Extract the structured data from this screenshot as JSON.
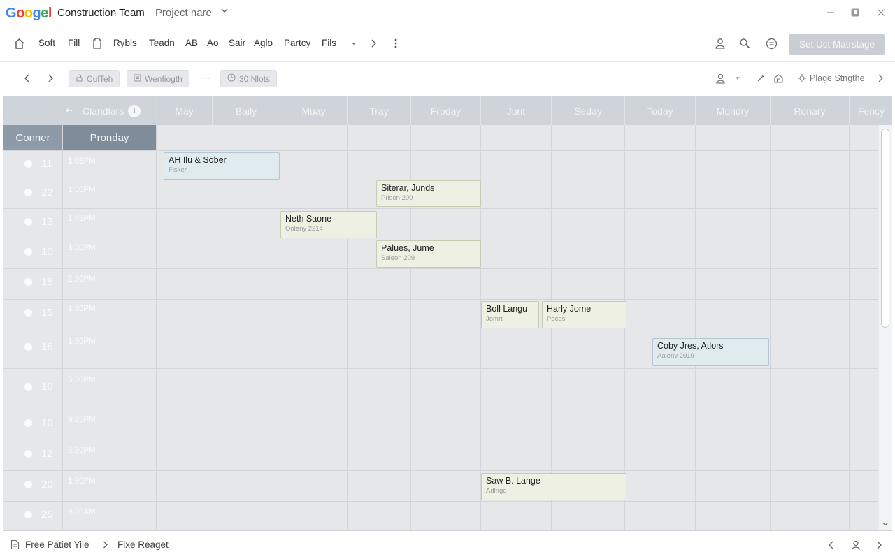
{
  "header": {
    "logo": [
      "G",
      "o",
      "o",
      "g",
      "e",
      "l"
    ],
    "logo_colors": [
      "#4285F4",
      "#EA4335",
      "#FBBC05",
      "#4285F4",
      "#34A853",
      "#EA4335"
    ],
    "app_title": "Construction Team",
    "project_name": "Project nare"
  },
  "menubar": {
    "items": [
      "Soft",
      "Fill",
      "Rybls",
      "Teadn",
      "AB",
      "Ao",
      "Sair",
      "Aglo",
      "Partcy",
      "Fils"
    ],
    "cta": "Set Uct Matrstage"
  },
  "toolbar": {
    "chip1": "CulTeh",
    "chip2": "Wenfiogth",
    "dots": "····",
    "chip3": "30 Nlots",
    "right_label": "Plage Stngthe"
  },
  "calendar": {
    "header_label": "Clandlars",
    "badge": "!",
    "days": [
      "May",
      "Baily",
      "Muay",
      "Tray",
      "Froday",
      "Junt",
      "Seday",
      "Today",
      "Mondry",
      "Ronary",
      "Fency"
    ],
    "sub_left": "Conner",
    "sub_right": "Pronday",
    "rows": [
      {
        "num": "11",
        "time": "1:05PM"
      },
      {
        "num": "22",
        "time": "1:30PM"
      },
      {
        "num": "13",
        "time": "1:45PM"
      },
      {
        "num": "10",
        "time": "1:30PM"
      },
      {
        "num": "18",
        "time": "2:30PM"
      },
      {
        "num": "15",
        "time": "1:30PM"
      },
      {
        "num": "16",
        "time": "1:30PM"
      },
      {
        "num": "10",
        "time": "5:30PM"
      },
      {
        "num": "10",
        "time": "9:25PM"
      },
      {
        "num": "12",
        "time": "5:30PM"
      },
      {
        "num": "20",
        "time": "1:30PM"
      },
      {
        "num": "25",
        "time": "9:36AM"
      }
    ],
    "events": [
      {
        "title": "AH Ilu & Sober",
        "sub": "Fisker"
      },
      {
        "title": "Siterar, Junds",
        "sub": "Prisen 200"
      },
      {
        "title": "Neth Saone",
        "sub": "Ooleny 2214"
      },
      {
        "title": "Palues, Jume",
        "sub": "Saleon 209"
      },
      {
        "title": "Boll Langu",
        "sub": "Jomrt"
      },
      {
        "title": "Harly Jome",
        "sub": "Poces"
      },
      {
        "title": "Coby Jres, Atlors",
        "sub": "Aalenv 2019"
      },
      {
        "title": "Saw B. Lange",
        "sub": "Adlnge"
      }
    ]
  },
  "footer": {
    "left": "Free Patiet Yile",
    "right": "Fixe Reaget"
  }
}
